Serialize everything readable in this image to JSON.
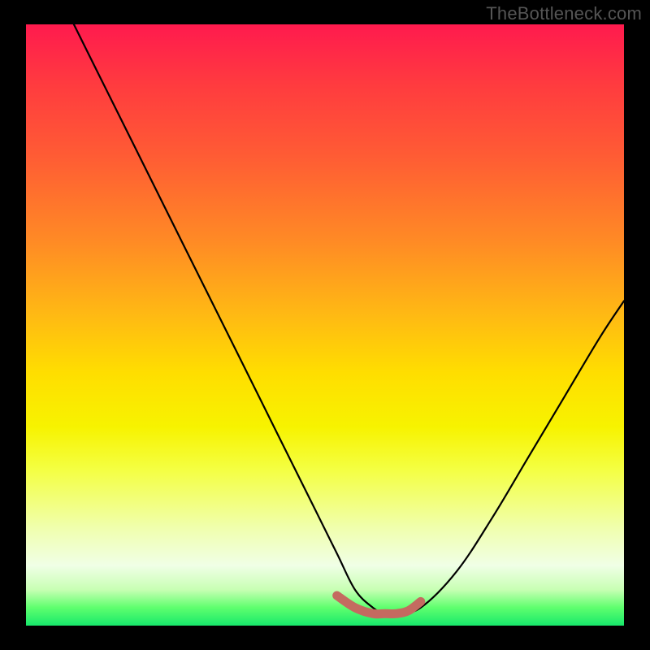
{
  "watermark": "TheBottleneck.com",
  "chart_data": {
    "type": "line",
    "title": "",
    "xlabel": "",
    "ylabel": "",
    "xlim": [
      0,
      100
    ],
    "ylim": [
      0,
      100
    ],
    "series": [
      {
        "name": "bottleneck-curve",
        "color": "#000000",
        "x": [
          8,
          12,
          18,
          24,
          30,
          36,
          42,
          48,
          52,
          55,
          58,
          60,
          62,
          66,
          72,
          78,
          84,
          90,
          96,
          100
        ],
        "y": [
          100,
          92,
          80,
          68,
          56,
          44,
          32,
          20,
          12,
          6,
          3,
          2,
          2,
          3,
          9,
          18,
          28,
          38,
          48,
          54
        ]
      },
      {
        "name": "optimal-range",
        "color": "#c86a5f",
        "x": [
          52,
          55,
          58,
          60,
          62,
          64,
          66
        ],
        "y": [
          5,
          3,
          2,
          2,
          2,
          2.5,
          4
        ]
      }
    ],
    "gradient_stops": [
      {
        "pos": 0,
        "color": "#ff1a4e"
      },
      {
        "pos": 10,
        "color": "#ff3b3f"
      },
      {
        "pos": 22,
        "color": "#ff5c34"
      },
      {
        "pos": 36,
        "color": "#ff8a25"
      },
      {
        "pos": 48,
        "color": "#ffb814"
      },
      {
        "pos": 58,
        "color": "#ffde00"
      },
      {
        "pos": 67,
        "color": "#f7f300"
      },
      {
        "pos": 74,
        "color": "#f4ff42"
      },
      {
        "pos": 84,
        "color": "#f0ffb0"
      },
      {
        "pos": 90,
        "color": "#f0ffe6"
      },
      {
        "pos": 94,
        "color": "#c8ffb4"
      },
      {
        "pos": 97,
        "color": "#5fff6e"
      },
      {
        "pos": 100,
        "color": "#17e86b"
      }
    ]
  }
}
